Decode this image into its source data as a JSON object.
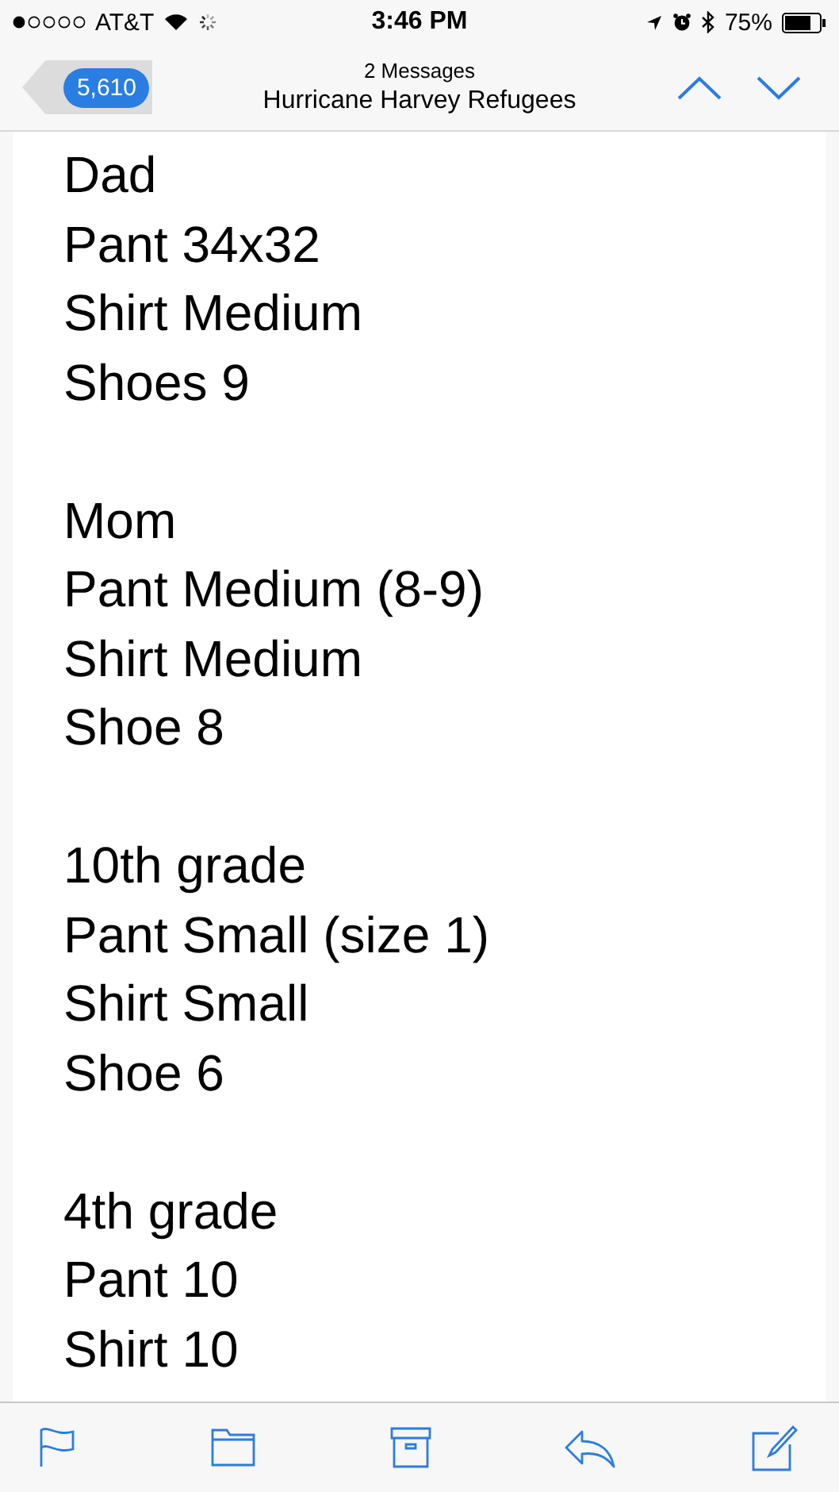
{
  "status_bar": {
    "carrier": "AT&T",
    "time": "3:46 PM",
    "battery": "75%"
  },
  "nav": {
    "back_count": "5,610",
    "subtitle": "2 Messages",
    "title": "Hurricane Harvey Refugees"
  },
  "message": {
    "groups": [
      {
        "lines": [
          "Dad",
          "Pant 34x32",
          "Shirt Medium",
          "Shoes 9"
        ]
      },
      {
        "lines": [
          "Mom",
          "Pant Medium (8-9)",
          "Shirt Medium",
          "Shoe 8"
        ]
      },
      {
        "lines": [
          "10th grade",
          "Pant Small (size 1)",
          "Shirt Small",
          "Shoe 6"
        ]
      },
      {
        "lines": [
          "4th grade",
          "Pant 10",
          "Shirt 10"
        ]
      }
    ]
  }
}
